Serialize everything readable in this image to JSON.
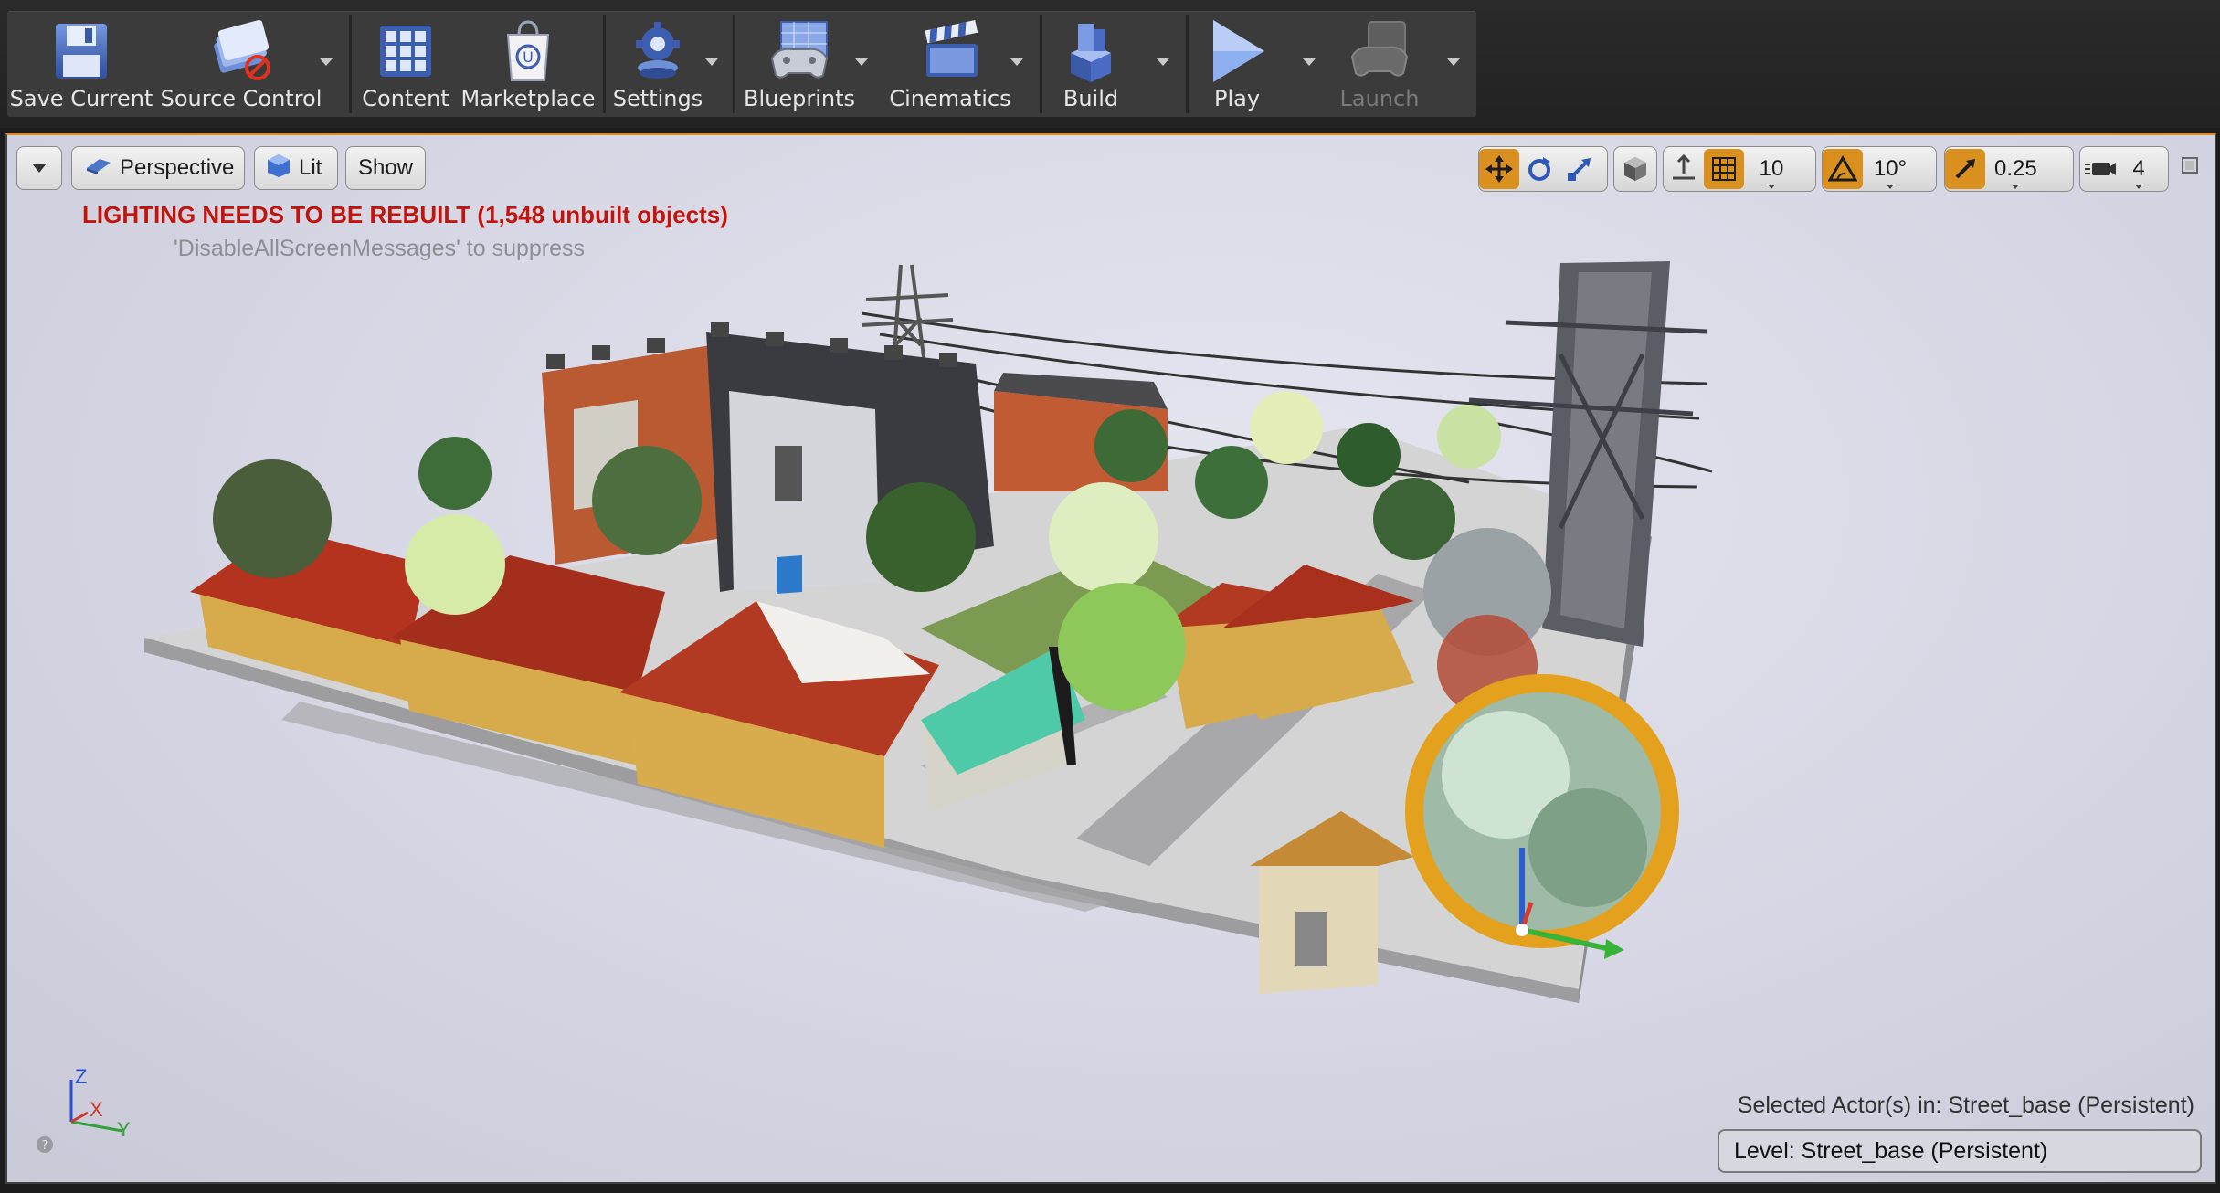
{
  "toolbar": {
    "buttons": [
      {
        "id": "save_current",
        "label": "Save Current",
        "icon": "floppy-disk-icon",
        "dropdown": false,
        "enabled": true
      },
      {
        "id": "source_control",
        "label": "Source Control",
        "icon": "source-control-disabled-icon",
        "dropdown": true,
        "enabled": true
      },
      {
        "id": "content",
        "label": "Content",
        "icon": "content-grid-icon",
        "dropdown": false,
        "enabled": true
      },
      {
        "id": "marketplace",
        "label": "Marketplace",
        "icon": "marketplace-bag-icon",
        "dropdown": false,
        "enabled": true
      },
      {
        "id": "settings",
        "label": "Settings",
        "icon": "settings-gear-icon",
        "dropdown": true,
        "enabled": true
      },
      {
        "id": "blueprints",
        "label": "Blueprints",
        "icon": "blueprints-gamepad-icon",
        "dropdown": true,
        "enabled": true
      },
      {
        "id": "cinematics",
        "label": "Cinematics",
        "icon": "clapperboard-icon",
        "dropdown": true,
        "enabled": true
      },
      {
        "id": "build",
        "label": "Build",
        "icon": "build-cubes-icon",
        "dropdown": true,
        "enabled": true
      },
      {
        "id": "play",
        "label": "Play",
        "icon": "play-triangle-icon",
        "dropdown": true,
        "enabled": true
      },
      {
        "id": "launch",
        "label": "Launch",
        "icon": "launch-gamepad-icon",
        "dropdown": true,
        "enabled": false
      }
    ]
  },
  "viewport": {
    "view_mode_label": "Perspective",
    "lighting_mode_label": "Lit",
    "show_label": "Show",
    "grid_snap_value": "10",
    "rotation_snap_value": "10°",
    "scale_snap_value": "0.25",
    "camera_speed_value": "4",
    "warning_message": "LIGHTING NEEDS TO BE REBUILT (1,548 unbuilt objects)",
    "suppress_hint": "'DisableAllScreenMessages' to suppress",
    "selected_actor_text": "Selected Actor(s) in:  Street_base (Persistent)",
    "level_text": "Level:  Street_base (Persistent)",
    "axis_labels": {
      "z": "Z",
      "x": "X",
      "y": "Y"
    }
  },
  "colors": {
    "accent_orange": "#d9901e",
    "warning_red": "#c0140c",
    "toolbar_bg": "#3b3b3b",
    "viewport_bg": "#d6d6e4"
  }
}
